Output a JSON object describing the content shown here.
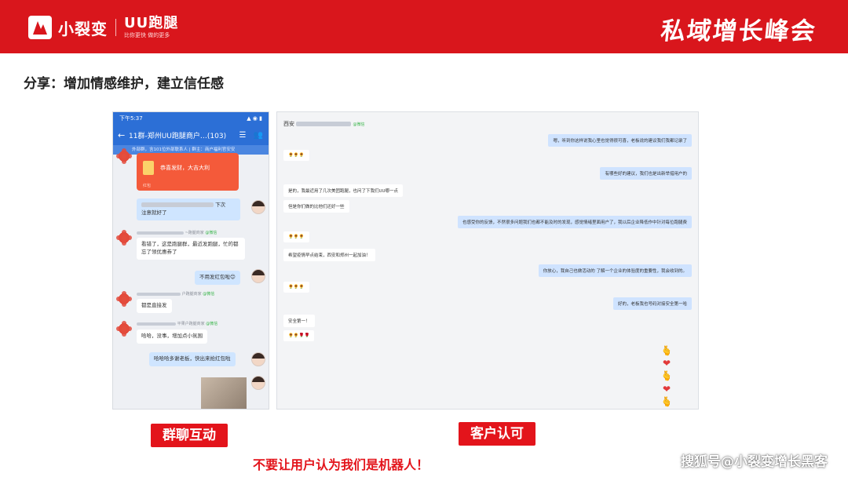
{
  "header": {
    "logo_text": "小裂变",
    "uu_title": "UU跑腿",
    "uu_sub": "比你更快 做的更多",
    "brand": "私域增长峰会"
  },
  "slide": {
    "title": "分享：增加情感维护，建立信任感"
  },
  "phone": {
    "status_time": "下午5:37",
    "status_right": "▲ ◉ ▮",
    "nav_title": "11群-郑州UU跑腿商户…(103)",
    "notice": "外部群，含101位外部联系人 | 群主：商户福利官安安",
    "redpack_text": "恭喜发财，大吉大利",
    "redpack_foot": "红包",
    "msg1_tail": "下次",
    "msg1_line2": "注意就好了",
    "sender1_suffix": "~跑腿商家",
    "wx_tag": "@微信",
    "msg2": "看错了，这是跑腿群，最近发跑腿，忙的都忘了领优惠券了",
    "msg3": "不用发红包啦😊",
    "sender2_suffix": "户跑腿商家",
    "msg4": "都是直接发",
    "sender3_suffix": "平果户跑腿商家",
    "msg5": "哈哈，没事，增加点小氛围",
    "msg6": "哈哈哈多谢老板，快出来抢红包啦"
  },
  "chat": {
    "head_name": "西安",
    "head_tag": "@微信",
    "messages": [
      {
        "side": "r",
        "text": "嗯，听到你这样说我心里也觉得很可喜，老板说的建议我们我都记录了"
      },
      {
        "side": "l",
        "text": "🌻🌻🌻"
      },
      {
        "side": "r",
        "text": "有哪些好的建议，我们也是出新举措用户的"
      },
      {
        "side": "l",
        "text": "是的，我最近用了几次美团跑腿，也问了下我们UU哪一点"
      },
      {
        "side": "l",
        "text": "但是你们做的比他们还好一些"
      },
      {
        "side": "r",
        "text": "也感受你的反馈，不然很多问题我们也都不能及时的发现，感觉情绪里面用户了，我以后企业降低作中针对每位跑腿费"
      },
      {
        "side": "l",
        "text": "🌻🌻🌻"
      },
      {
        "side": "l",
        "text": "希望疫情早点结束，西安和郑州一起加油！"
      },
      {
        "side": "r",
        "text": "你放心，我自己也做活动的 了解一个企业的体验度的重要性，我会收到的。"
      },
      {
        "side": "l",
        "text": "🌻🌻🌻"
      },
      {
        "side": "r",
        "text": "好的，老板我也号码对接安全第一哈"
      },
      {
        "side": "l",
        "text": "安全第一！"
      },
      {
        "side": "l",
        "text": "🌻🌻🌹🌹"
      }
    ],
    "side_icons": [
      "🫰",
      "❤",
      "🫰",
      "❤",
      "🫰"
    ]
  },
  "labels": {
    "left": "群聊互动",
    "right": "客户认可",
    "warning": "不要让用户认为我们是机器人！"
  },
  "watermark": "搜狐号@小裂变增长黑客"
}
